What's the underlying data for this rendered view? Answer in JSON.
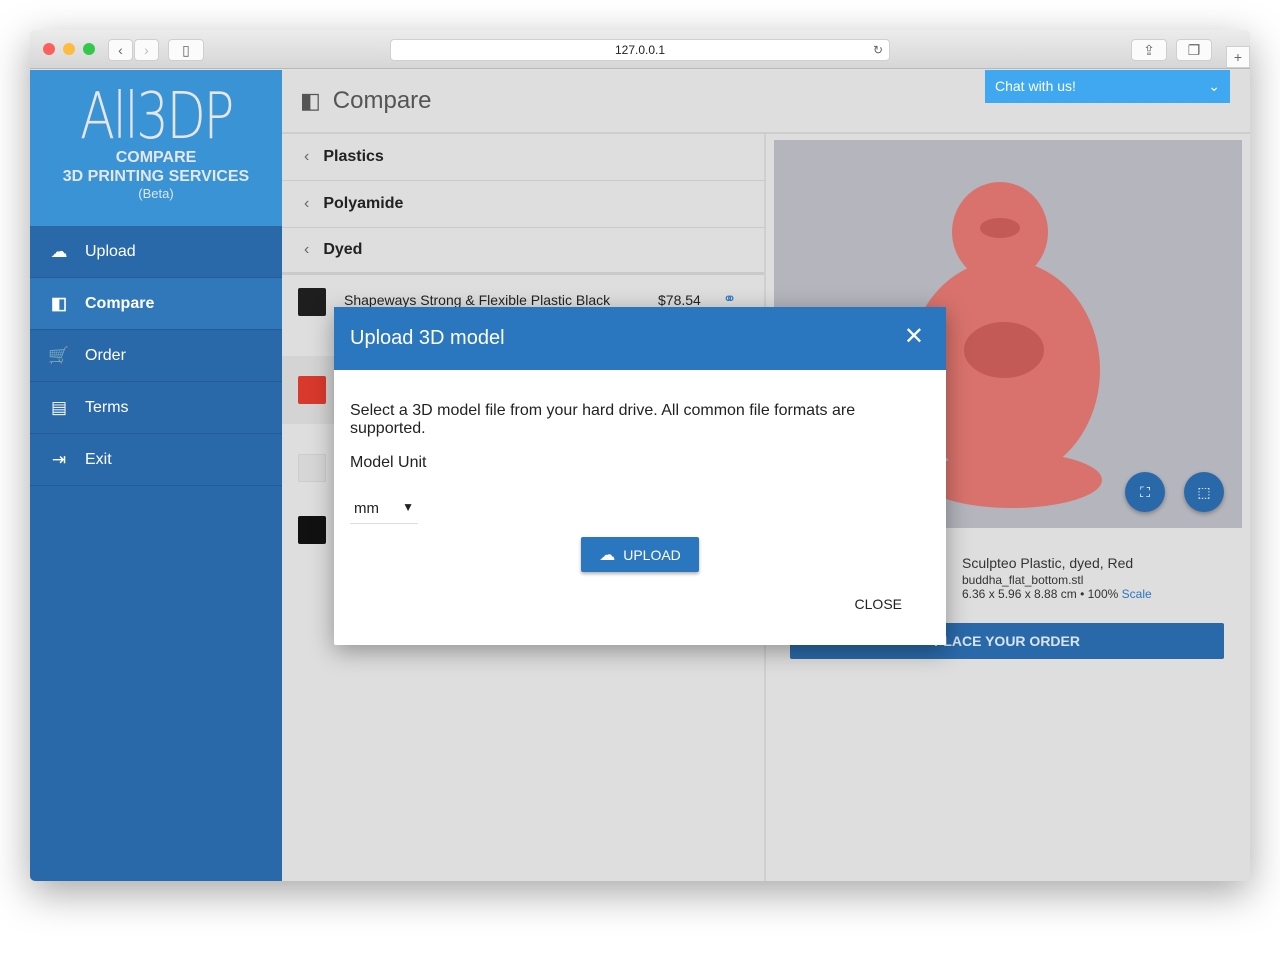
{
  "browser": {
    "url": "127.0.0.1"
  },
  "sidebar": {
    "logo": "All3DP",
    "line1": "COMPARE",
    "line2": "3D PRINTING SERVICES",
    "beta": "(Beta)",
    "items": [
      {
        "label": "Upload",
        "icon": "cloud-upload-icon"
      },
      {
        "label": "Compare",
        "icon": "compare-icon"
      },
      {
        "label": "Order",
        "icon": "cart-icon"
      },
      {
        "label": "Terms",
        "icon": "document-icon"
      },
      {
        "label": "Exit",
        "icon": "exit-icon"
      }
    ]
  },
  "header": {
    "title": "Compare",
    "chat": "Chat with us!"
  },
  "breadcrumbs": [
    "Plastics",
    "Polyamide",
    "Dyed"
  ],
  "results": [
    {
      "name": "Shapeways Strong & Flexible Plastic Black",
      "price": "$78.54",
      "color": "#1e1e1e"
    },
    {
      "color": "#d9392c"
    },
    {
      "color": "#d6d6d6"
    },
    {
      "color": "#111111"
    }
  ],
  "model": {
    "material": "Sculpteo Plastic, dyed, Red",
    "file": "buddha_flat_bottom.stl",
    "dims": "6.36 x 5.96 x 8.88 cm • 100%",
    "scale": "Scale",
    "order": "PLACE YOUR ORDER"
  },
  "modal": {
    "title": "Upload 3D model",
    "desc": "Select a 3D model file from your hard drive. All common file formats are supported.",
    "unit_label": "Model Unit",
    "unit": "mm",
    "upload": "UPLOAD",
    "close": "CLOSE"
  }
}
